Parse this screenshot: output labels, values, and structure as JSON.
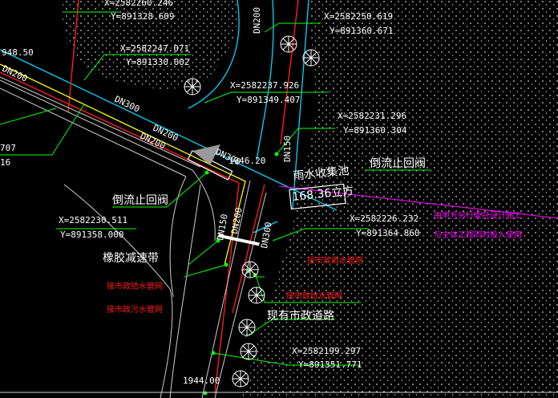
{
  "colors": {
    "background": "#000000",
    "cyan": "#00d7ff",
    "red": "#ff1a1a",
    "white": "#ffffff",
    "green": "#00ff00",
    "yellow": "#ffff00",
    "magenta": "#ff00ff",
    "gray": "#c8c8c8"
  },
  "coords": [
    {
      "x": "X=2582260.246",
      "y": "Y=891328.609"
    },
    {
      "x": "X=2582250.619",
      "y": "Y=891360.671"
    },
    {
      "x": "X=2582247.071",
      "y": "Y=891330.002"
    },
    {
      "x": "X=2582237.926",
      "y": "Y=891349.407"
    },
    {
      "x": "X=2582231.296",
      "y": "Y=891360.304"
    },
    {
      "x": "X=2582230.511",
      "y": "Y=891358.000"
    },
    {
      "x": "X=2582226.232",
      "y": "Y=891364.860"
    },
    {
      "x": "X=2582199.297",
      "y": "Y=891351.771"
    }
  ],
  "left_fragments": [
    "948.50",
    "707",
    "16"
  ],
  "pipe_labels": [
    "DN200",
    "DN300",
    "DN200",
    "DN200",
    "DN300",
    "DN200",
    "DN150",
    "DN150",
    "DN200",
    "DN300"
  ],
  "elevations": [
    "1946.20",
    "1944.00"
  ],
  "features": {
    "check_valve_right": "倒流止回阀",
    "check_valve_left": "倒流止回阀",
    "rain_tank": "雨水收集池",
    "rain_tank_volume": "168.36立方",
    "rubber_bump": "橡胶减速带",
    "road": "现有市政道路"
  },
  "connections": {
    "rain_pipe": "接市政雨水管网",
    "supply_pipe_right": "接市政给水管网",
    "supply_pipe_left": "接市政给水管网",
    "sewer_pipe": "接市政污水管网"
  },
  "notes": [
    "由甲方另行委托设计施工",
    "与主体工程同时投入使用"
  ]
}
